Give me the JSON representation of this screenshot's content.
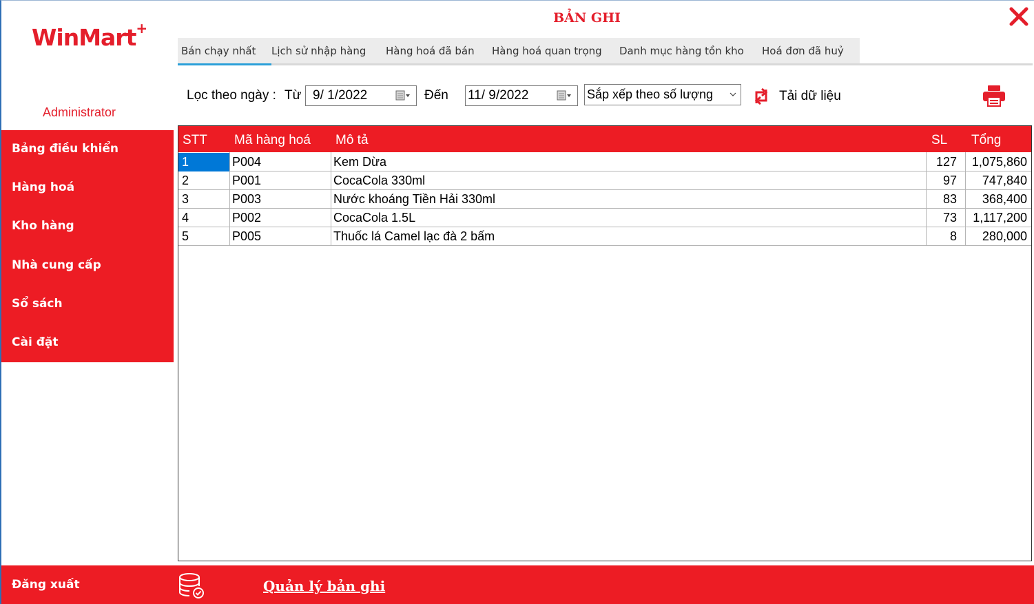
{
  "brand": {
    "name": "WinMart",
    "plus": "+"
  },
  "user": "Administrator",
  "title": "BẢN GHI",
  "sidebar": {
    "items": [
      "Bảng điều khiển",
      "Hàng hoá",
      "Kho hàng",
      "Nhà cung cấp",
      "Sổ sách",
      "Cài đặt"
    ],
    "logout": "Đăng xuất"
  },
  "tabs": [
    "Bán chạy nhất",
    "Lịch sử nhập hàng",
    "Hàng hoá đã bán",
    "Hàng hoá quan trọng",
    "Danh mục hàng tồn kho",
    "Hoá đơn đã huỷ"
  ],
  "active_tab": "Bán chạy nhất",
  "filter": {
    "label": "Lọc theo ngày :",
    "from_label": "Từ",
    "from_value": "9/ 1/2022",
    "to_label": "Đến",
    "to_value": "11/ 9/2022",
    "sort_value": "Sắp xếp theo số lượng",
    "reload_label": "Tải dữ liệu"
  },
  "table": {
    "columns": [
      "STT",
      "Mã hàng hoá",
      "Mô tả",
      "SL",
      "Tổng"
    ],
    "rows": [
      [
        "1",
        "P004",
        "Kem Dừa",
        "127",
        "1,075,860"
      ],
      [
        "2",
        "P001",
        "CocaCola 330ml",
        "97",
        "747,840"
      ],
      [
        "3",
        "P003",
        "Nước khoáng Tiền Hải 330ml",
        "83",
        "368,400"
      ],
      [
        "4",
        "P002",
        "CocaCola 1.5L",
        "73",
        "1,117,200"
      ],
      [
        "5",
        "P005",
        "Thuốc lá Camel lạc đà 2 bấm",
        "8",
        "280,000"
      ]
    ]
  },
  "footer": {
    "link": "Quản lý bản ghi"
  },
  "colors": {
    "brand_red": "#ed1c24",
    "selected_cell": "#0078d7",
    "tab_accent": "#2a9fd8"
  },
  "icons": [
    "close-icon",
    "calendar-icon",
    "chevron-down-icon",
    "reload-icon",
    "printer-icon",
    "database-icon"
  ]
}
